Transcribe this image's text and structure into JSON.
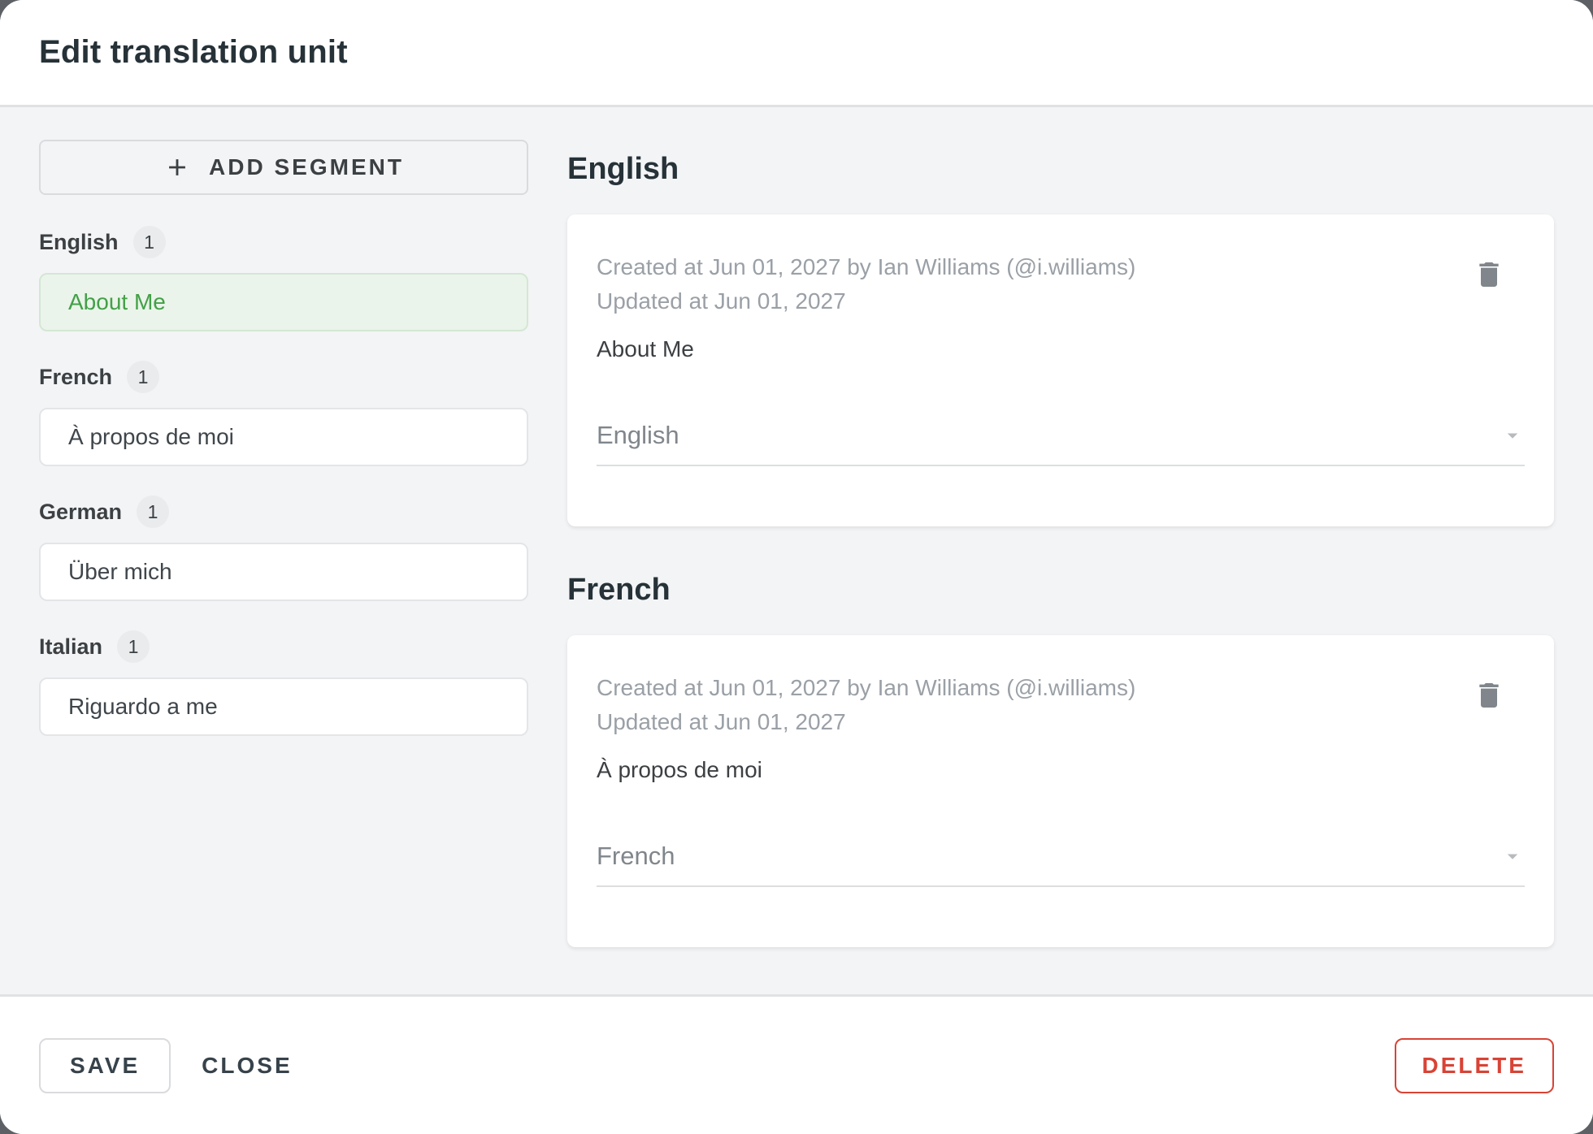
{
  "dialog": {
    "title": "Edit translation unit"
  },
  "sidebar": {
    "add_segment_label": "ADD SEGMENT",
    "groups": [
      {
        "language": "English",
        "count": "1",
        "segment": "About Me",
        "selected": true
      },
      {
        "language": "French",
        "count": "1",
        "segment": "À propos de moi",
        "selected": false
      },
      {
        "language": "German",
        "count": "1",
        "segment": "Über mich",
        "selected": false
      },
      {
        "language": "Italian",
        "count": "1",
        "segment": "Riguardo a me",
        "selected": false
      }
    ]
  },
  "main": {
    "sections": [
      {
        "heading": "English",
        "created_line": "Created at Jun 01, 2027 by Ian Williams (@i.williams)",
        "updated_line": "Updated at Jun 01, 2027",
        "text": "About Me",
        "language_select": "English"
      },
      {
        "heading": "French",
        "created_line": "Created at Jun 01, 2027 by Ian Williams (@i.williams)",
        "updated_line": "Updated at Jun 01, 2027",
        "text": "À propos de moi",
        "language_select": "French"
      }
    ]
  },
  "footer": {
    "save_label": "SAVE",
    "close_label": "CLOSE",
    "delete_label": "DELETE"
  },
  "icons": {
    "add_segment": "plus-icon",
    "delete_segment": "trash-icon",
    "language_dropdown": "caret-down-icon"
  },
  "colors": {
    "accent_green": "#43a047",
    "selected_segment_bg": "#eaf4ea",
    "delete_red": "#d84335",
    "backdrop": "#5d6165",
    "body_bg": "#f3f4f6",
    "meta_gray": "#9aa0a6"
  }
}
